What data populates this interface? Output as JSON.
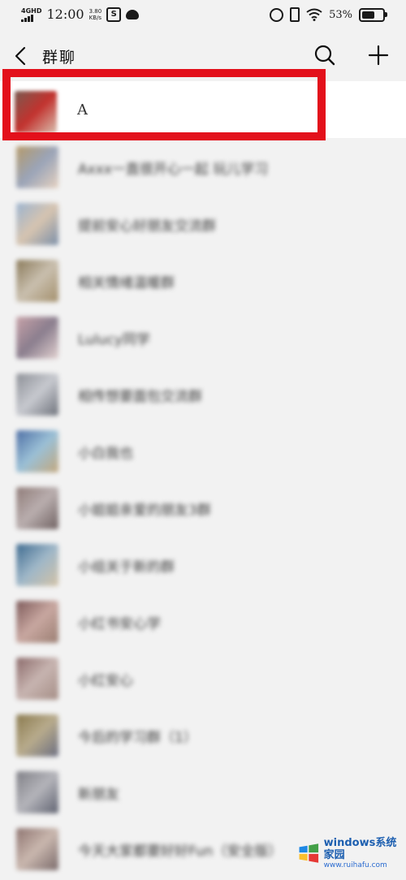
{
  "status_bar": {
    "network": "4GHD",
    "time": "12:00",
    "speed_value": "3.80",
    "speed_unit": "KB/s",
    "battery_percent": "53%",
    "battery_level": 0.53
  },
  "header": {
    "title": "群聊",
    "icons": [
      "back-arrow",
      "search",
      "plus"
    ]
  },
  "groups": [
    {
      "name": "A",
      "colors": [
        "#7a5a50",
        "#c2322e",
        "#d9c0b0"
      ]
    },
    {
      "name": "Axxx一直很开心一起 玩儿学习",
      "colors": [
        "#b59a6a",
        "#9aa4b8",
        "#e6d2c0"
      ]
    },
    {
      "name": "提前安心好朋友交流群",
      "colors": [
        "#9bb3cf",
        "#d6c4b0",
        "#7a8ea8"
      ]
    },
    {
      "name": "相关情绪温暖群",
      "colors": [
        "#8a7a5a",
        "#c9bfae",
        "#a38f6c"
      ]
    },
    {
      "name": "Lulucy同学",
      "colors": [
        "#c7a2a8",
        "#8b7e8e",
        "#e2d1d0"
      ]
    },
    {
      "name": "相传想要面包交流群",
      "colors": [
        "#8c8f96",
        "#c7c9cf",
        "#6d717a"
      ]
    },
    {
      "name": "小白我也",
      "colors": [
        "#4e6fa5",
        "#9bc0d6",
        "#c3a77c"
      ]
    },
    {
      "name": "小姐姐亲爱的朋友3群",
      "colors": [
        "#8f7b78",
        "#b9aeae",
        "#6f6161"
      ]
    },
    {
      "name": "小组关于新的群",
      "colors": [
        "#3d6a8f",
        "#9fb7c8",
        "#d3c2a6"
      ]
    },
    {
      "name": "小红书安心学",
      "colors": [
        "#7d5a5a",
        "#c8a7a0",
        "#9a7e72"
      ]
    },
    {
      "name": "小红安心",
      "colors": [
        "#8b6a6a",
        "#c7b4b0",
        "#a58e86"
      ]
    },
    {
      "name": "今后的学习群（1）",
      "colors": [
        "#8a7a4e",
        "#b8ab8c",
        "#6a6d80"
      ]
    },
    {
      "name": "新朋友",
      "colors": [
        "#7f7f86",
        "#b4b4ba",
        "#5f6270"
      ]
    },
    {
      "name": "今天大家都要好好Fun（安全版）",
      "colors": [
        "#8e7470",
        "#c9b7ae",
        "#7a6a6a"
      ]
    }
  ],
  "watermark": {
    "brand": "windows系统家园",
    "url": "www.ruihafu.com"
  },
  "highlight_color": "#e3101b"
}
